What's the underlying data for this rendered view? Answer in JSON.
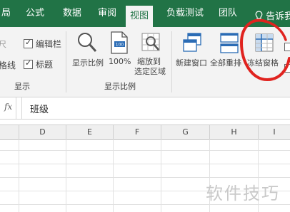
{
  "tabs": [
    {
      "label": "局",
      "active": false
    },
    {
      "label": "公式",
      "active": false
    },
    {
      "label": "数据",
      "active": false
    },
    {
      "label": "审阅",
      "active": false
    },
    {
      "label": "视图",
      "active": true
    },
    {
      "label": "负载测试",
      "active": false
    },
    {
      "label": "团队",
      "active": false
    }
  ],
  "tell_me": {
    "icon": "lightbulb-icon",
    "label": "告诉我"
  },
  "ribbon": {
    "show_group": {
      "items": {
        "ruler": "尺",
        "gridlines": "格线",
        "formula_bar": "编辑栏",
        "headings": "标题"
      },
      "group_label": "显示"
    },
    "zoom_group": {
      "zoom": "显示比例",
      "zoom_100": "100%",
      "zoom_selection_line1": "缩放到",
      "zoom_selection_line2": "选定区域",
      "group_label": "显示比例"
    },
    "window_group": {
      "new_window": "新建窗口",
      "arrange_all": "全部重排",
      "freeze_panes": "冻结窗格"
    }
  },
  "formula_bar": {
    "fx_icon": "function-icon",
    "fx_label": "fx",
    "value": "班级"
  },
  "sheet": {
    "columns": [
      "D",
      "E",
      "F",
      "G",
      "H",
      "I"
    ]
  },
  "watermark": "软件技巧",
  "colors": {
    "accent": "#217346",
    "annotation": "#e0231f"
  }
}
